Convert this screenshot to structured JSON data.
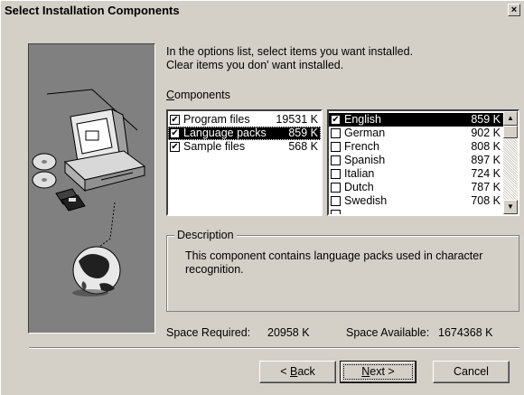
{
  "window": {
    "title": "Select Installation Components",
    "close_glyph": "×"
  },
  "instructions": {
    "line1": "In the options list, select items you want installed.",
    "line2": "Clear items you don' want installed."
  },
  "components_label": "Components",
  "components_accel": "C",
  "components_rest": "omponents",
  "components": [
    {
      "name": "Program files",
      "size": "19531 K",
      "checked": true
    },
    {
      "name": "Language packs",
      "size": "859 K",
      "checked": true,
      "selected": true
    },
    {
      "name": "Sample files",
      "size": "568 K",
      "checked": true
    }
  ],
  "languages": [
    {
      "name": "English",
      "size": "859 K",
      "checked": true,
      "selected": true
    },
    {
      "name": "German",
      "size": "902 K",
      "checked": false
    },
    {
      "name": "French",
      "size": "808 K",
      "checked": false
    },
    {
      "name": "Spanish",
      "size": "897 K",
      "checked": false
    },
    {
      "name": "Italian",
      "size": "724 K",
      "checked": false
    },
    {
      "name": "Dutch",
      "size": "787 K",
      "checked": false
    },
    {
      "name": "Swedish",
      "size": "708 K",
      "checked": false
    }
  ],
  "description": {
    "title": "Description",
    "text": "This component contains language packs used in character recognition."
  },
  "space": {
    "required_label": "Space Required:",
    "required_value": "20958 K",
    "available_label": "Space Available:",
    "available_value": "1674368 K"
  },
  "buttons": {
    "back": "< Back",
    "back_pre": "< ",
    "back_accel": "B",
    "back_rest": "ack",
    "next_accel": "N",
    "next_rest": "ext >",
    "cancel": "Cancel"
  },
  "icons": {
    "check": "✔",
    "scroll_up": "▲",
    "scroll_down": "▼"
  }
}
